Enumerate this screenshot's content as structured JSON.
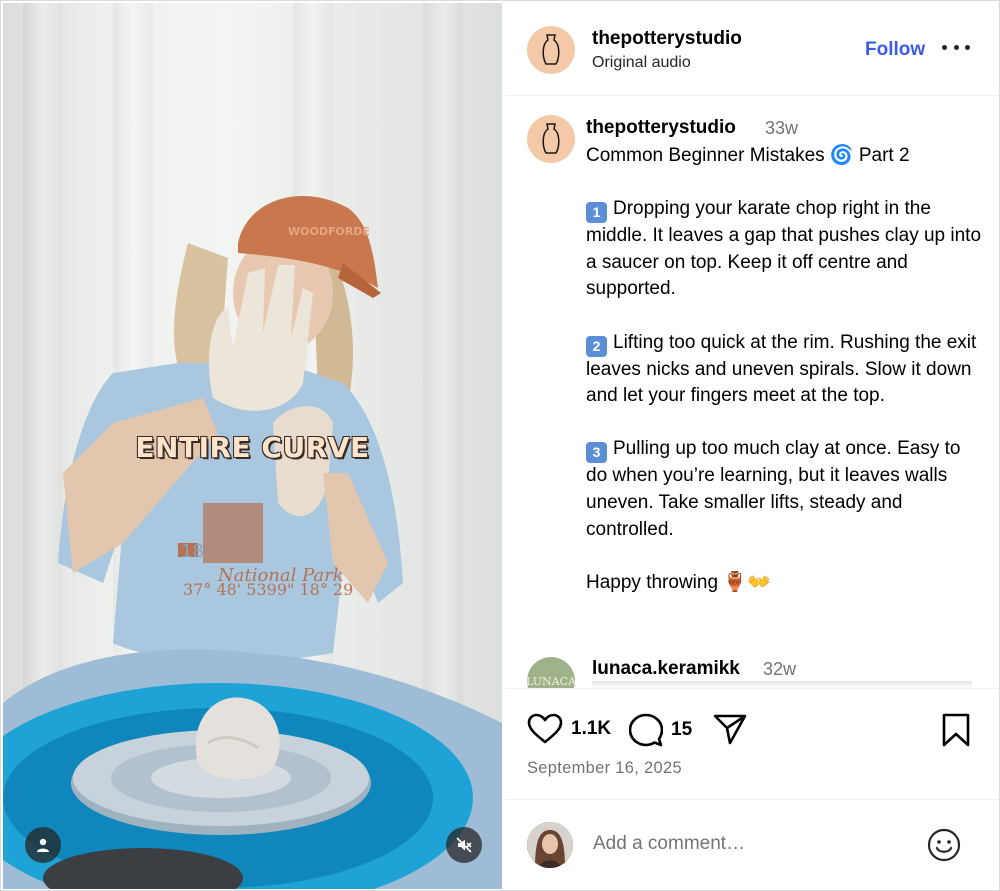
{
  "media": {
    "overlay_caption": "ENTIRE CURVE",
    "user_tag_icon": "person-icon",
    "mute_icon": "speaker-muted-icon"
  },
  "header": {
    "username": "thepotterystudio",
    "subtitle": "Original audio",
    "follow_label": "Follow",
    "more_icon": "ellipsis-icon"
  },
  "caption": {
    "username": "thepotterystudio",
    "time": "33w",
    "title": "Common Beginner Mistakes 🌀 Part 2",
    "items": [
      {
        "num": "1",
        "text": "Dropping your karate chop right in the middle. It leaves a gap that pushes clay up into a saucer on top. Keep it off centre and supported."
      },
      {
        "num": "2",
        "text": "Lifting too quick at the rim. Rushing the exit leaves nicks and uneven spirals. Slow it down and let your fingers meet at the top."
      },
      {
        "num": "3",
        "text": "Pulling up too much clay at once. Easy to do when you’re learning, but it leaves walls uneven. Take smaller lifts, steady and controlled."
      }
    ],
    "signoff": "Happy throwing",
    "signoff_emoji": "🏺👐"
  },
  "comment2": {
    "username": "lunaca.keramikk",
    "time": "32w",
    "avatar_text": "LUNACA"
  },
  "actions": {
    "likes": "1.1K",
    "comments": "15",
    "date": "September 16, 2025"
  },
  "add_comment": {
    "placeholder": "Add a comment…"
  },
  "colors": {
    "accent": "#3b5be8",
    "avatar_bg": "#f4c9a7",
    "muted_text": "#737373"
  }
}
